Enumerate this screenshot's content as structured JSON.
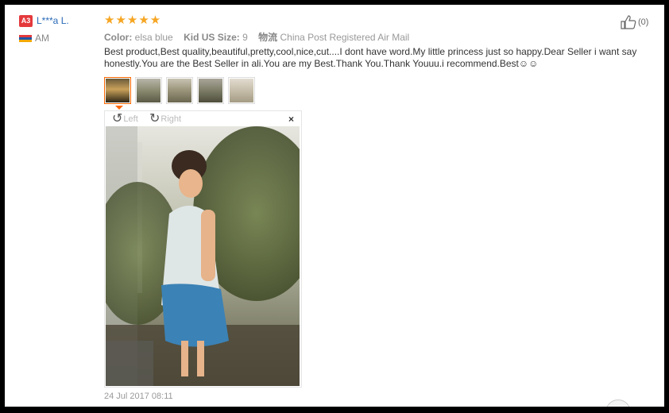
{
  "review": {
    "user_level": "A3",
    "user_name": "L***a L.",
    "country": "AM",
    "stars_text": "★★★★★",
    "color_label": "Color:",
    "color_value": "elsa blue",
    "size_label": "Kid US Size:",
    "size_value": "9",
    "shipping_label": "物流",
    "shipping_value": "China Post Registered Air Mail",
    "feedback_text": "Best product,Best quality,beautiful,pretty,cool,nice,cut....I dont have word.My little princess just so happy.Dear Seller i want say honestly.You are the Best Seller in ali.You are my Best.Thank You.Thank Youuu.i recommend.Best☺☺",
    "helpful_count": "(0)",
    "date": "24 Jul 2017 08:11"
  },
  "viewer": {
    "rotate_left_label": "Left",
    "rotate_right_label": "Right",
    "close_symbol": "×"
  },
  "colors": {
    "stars": "#f6a623",
    "selected_thumb": "#ff6600",
    "user_link": "#2a6ab8"
  },
  "icons": [
    "thumbs-up-icon",
    "rotate-left-icon",
    "rotate-right-icon",
    "close-icon",
    "country-flag-icon"
  ]
}
